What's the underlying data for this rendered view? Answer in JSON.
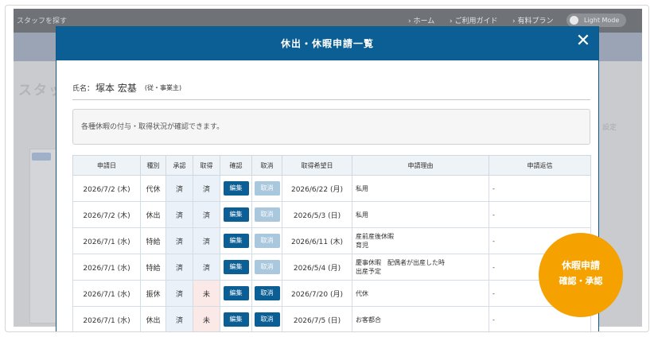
{
  "background": {
    "search_text": "スタッフを探す",
    "nav": [
      "› ホーム",
      "› ご利用ガイド",
      "› 有料プラン"
    ],
    "light_mode": "Light Mode",
    "page_heading": "スタッ",
    "right_text": "設定"
  },
  "modal": {
    "title": "休出・休暇申請一覧",
    "close_symbol": "✕",
    "name_label": "氏名：",
    "name_value": "塚本 宏基",
    "name_role": "(従・事業主)",
    "notice": "各種休暇の付与・取得状況が確認できます。",
    "table": {
      "headers": [
        "申請日",
        "種別",
        "承認",
        "取得",
        "確認",
        "取消",
        "取得希望日",
        "申請理由",
        "申請返信"
      ],
      "rows": [
        {
          "date": "2026/7/2 (木)",
          "type": "代休",
          "approved": "済",
          "taken": "済",
          "edit": "編集",
          "cancel": "取消",
          "cancel_enabled": false,
          "desired": "2026/6/22 (月)",
          "reason": "私用",
          "reply": "-"
        },
        {
          "date": "2026/7/2 (木)",
          "type": "休出",
          "approved": "済",
          "taken": "済",
          "edit": "編集",
          "cancel": "取消",
          "cancel_enabled": false,
          "desired": "2026/5/3 (日)",
          "reason": "私用",
          "reply": "-"
        },
        {
          "date": "2026/7/1 (水)",
          "type": "特給",
          "approved": "済",
          "taken": "済",
          "edit": "編集",
          "cancel": "取消",
          "cancel_enabled": false,
          "desired": "2026/6/11 (木)",
          "reason": "産前産後休暇\n育児",
          "reply": "-"
        },
        {
          "date": "2026/7/1 (水)",
          "type": "特給",
          "approved": "済",
          "taken": "済",
          "edit": "編集",
          "cancel": "取消",
          "cancel_enabled": false,
          "desired": "2026/5/4 (月)",
          "reason": "慶事休暇　配偶者が出産した時\n出産予定",
          "reply": "-"
        },
        {
          "date": "2026/7/1 (水)",
          "type": "振休",
          "approved": "済",
          "taken": "未",
          "edit": "編集",
          "cancel": "取消",
          "cancel_enabled": true,
          "desired": "2026/7/20 (月)",
          "reason": "代休",
          "reply": "-"
        },
        {
          "date": "2026/7/1 (水)",
          "type": "休出",
          "approved": "済",
          "taken": "未",
          "edit": "編集",
          "cancel": "取消",
          "cancel_enabled": true,
          "desired": "2026/7/5 (日)",
          "reason": "お客都合",
          "reply": "-"
        }
      ]
    }
  },
  "badge": {
    "line1": "休暇申請",
    "line2": "確認・承認",
    "color": "#f5a100"
  },
  "colors": {
    "primary": "#0b5f95",
    "disabled_button": "#a9c7dd",
    "pending_cell": "#fbe9e8"
  }
}
